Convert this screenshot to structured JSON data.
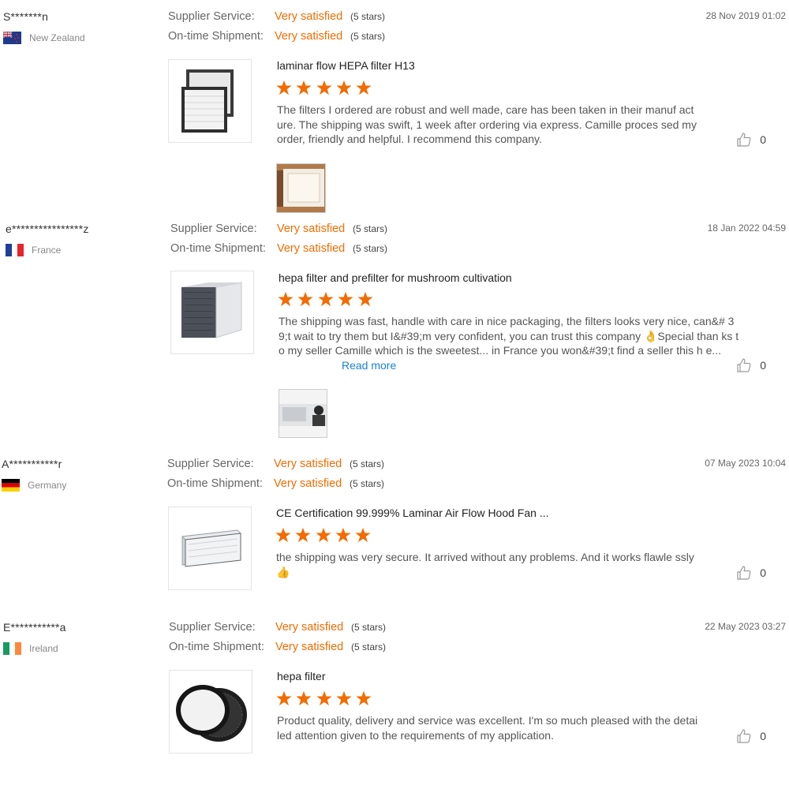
{
  "reviews": [
    {
      "buyer": "S*******n",
      "country": "New Zealand",
      "date": "28 Nov 2019 01:02",
      "supplier_service": {
        "label": "Supplier Service:",
        "value": "Very satisfied",
        "stars": "(5 stars)"
      },
      "shipment": {
        "label": "On-time Shipment:",
        "value": "Very satisfied",
        "stars": "(5 stars)"
      },
      "product_title": "laminar flow HEPA filter H13",
      "rating": 5,
      "text": "The filters I ordered are robust and well made, care has been taken in their manuf acture. The shipping was swift, 1 week after ordering via express. Camille proces sed my order, friendly and helpful. I recommend this company.",
      "likes": "0",
      "star_color": "#f26c00"
    },
    {
      "buyer": "e****************z",
      "country": "France",
      "date": "18 Jan 2022 04:59",
      "supplier_service": {
        "label": "Supplier Service:",
        "value": "Very satisfied",
        "stars": "(5 stars)"
      },
      "shipment": {
        "label": "On-time Shipment:",
        "value": "Very satisfied",
        "stars": "(5 stars)"
      },
      "product_title": "hepa filter and prefilter for mushroom cultivation",
      "rating": 5,
      "text": "The shipping was fast, handle with care in nice packaging, the filters looks very nice, can&# 39;t wait to try them but I&#39;m very confident, you can trust this company 👌Special than ks to my seller Camille which is the sweetest... in France you won&#39;t find a seller this h e...",
      "read_more": "Read more",
      "likes": "0"
    },
    {
      "buyer": "A***********r",
      "country": "Germany",
      "date": "07 May 2023 10:04",
      "supplier_service": {
        "label": "Supplier Service:",
        "value": "Very satisfied",
        "stars": "(5 stars)"
      },
      "shipment": {
        "label": "On-time Shipment:",
        "value": "Very satisfied",
        "stars": "(5 stars)"
      },
      "product_title": "CE Certification 99.999% Laminar Air Flow Hood Fan ...",
      "rating": 5,
      "text": "the shipping was very secure. It arrived without any problems. And it works flawle ssly👍",
      "likes": "0"
    },
    {
      "buyer": "E***********a",
      "country": "Ireland",
      "date": "22 May 2023 03:27",
      "supplier_service": {
        "label": "Supplier Service:",
        "value": "Very satisfied",
        "stars": "(5 stars)"
      },
      "shipment": {
        "label": "On-time Shipment:",
        "value": "Very satisfied",
        "stars": "(5 stars)"
      },
      "product_title": "hepa filter",
      "rating": 5,
      "text": "Product quality, delivery and service was excellent. I'm so much pleased with the detailed attention given to the requirements of my application.",
      "likes": "0"
    }
  ]
}
